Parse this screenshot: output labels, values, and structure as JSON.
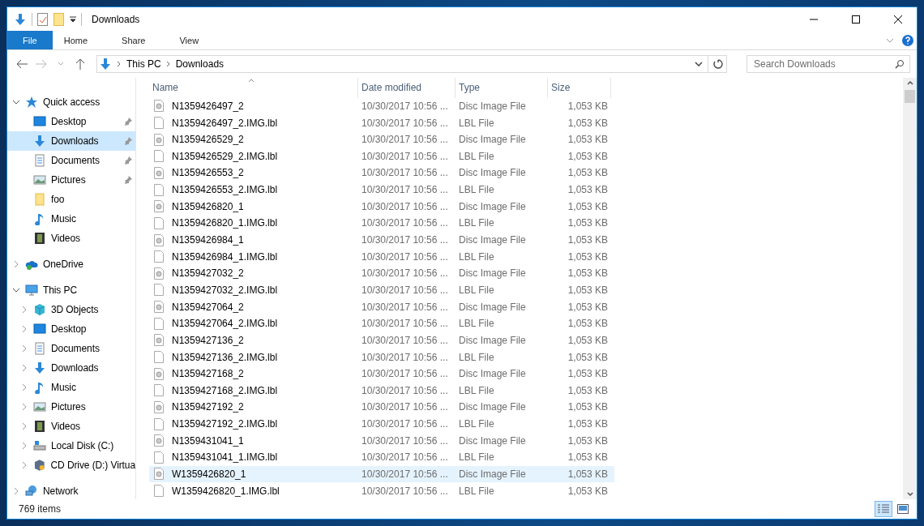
{
  "window": {
    "title": "Downloads"
  },
  "ribbon_tabs": [
    {
      "label": "File",
      "selected": true
    },
    {
      "label": "Home",
      "selected": false
    },
    {
      "label": "Share",
      "selected": false
    },
    {
      "label": "View",
      "selected": false
    }
  ],
  "breadcrumb": [
    "This PC",
    "Downloads"
  ],
  "search": {
    "placeholder": "Search Downloads"
  },
  "sidebar": [
    {
      "label": "Quick access",
      "kind": "star",
      "expanded": true,
      "children": [
        {
          "label": "Desktop",
          "kind": "desktop",
          "pinned": true,
          "selected": false
        },
        {
          "label": "Downloads",
          "kind": "download",
          "pinned": true,
          "selected": true
        },
        {
          "label": "Documents",
          "kind": "documents",
          "pinned": true,
          "selected": false
        },
        {
          "label": "Pictures",
          "kind": "pictures",
          "pinned": true,
          "selected": false
        },
        {
          "label": "foo",
          "kind": "folder",
          "pinned": false,
          "selected": false
        },
        {
          "label": "Music",
          "kind": "music",
          "pinned": false,
          "selected": false
        },
        {
          "label": "Videos",
          "kind": "videos",
          "pinned": false,
          "selected": false
        }
      ]
    },
    {
      "label": "OneDrive",
      "kind": "cloud",
      "expanded": false
    },
    {
      "label": "This PC",
      "kind": "pc",
      "expanded": true,
      "children": [
        {
          "label": "3D Objects",
          "kind": "cube",
          "expanded": false,
          "selected": false
        },
        {
          "label": "Desktop",
          "kind": "desktop",
          "expanded": false,
          "selected": false
        },
        {
          "label": "Documents",
          "kind": "documents",
          "expanded": false,
          "selected": false
        },
        {
          "label": "Downloads",
          "kind": "download",
          "expanded": false,
          "selected": false
        },
        {
          "label": "Music",
          "kind": "music",
          "expanded": false,
          "selected": false
        },
        {
          "label": "Pictures",
          "kind": "pictures",
          "expanded": false,
          "selected": false
        },
        {
          "label": "Videos",
          "kind": "videos",
          "expanded": false,
          "selected": false
        },
        {
          "label": "Local Disk (C:)",
          "kind": "disk",
          "expanded": false,
          "selected": false
        },
        {
          "label": "CD Drive (D:) Virtua",
          "kind": "cd",
          "expanded": false,
          "selected": false
        }
      ]
    },
    {
      "label": "Network",
      "kind": "network",
      "expanded": false
    }
  ],
  "table": {
    "columns": [
      "Name",
      "Date modified",
      "Type",
      "Size"
    ],
    "rows": [
      {
        "kind": "disc",
        "name": "N1359426497_2",
        "date": "10/30/2017 10:56 ...",
        "type": "Disc Image File",
        "size": "1,053 KB",
        "selected": false
      },
      {
        "kind": "lbl",
        "name": "N1359426497_2.IMG.lbl",
        "date": "10/30/2017 10:56 ...",
        "type": "LBL File",
        "size": "1,053 KB",
        "selected": false
      },
      {
        "kind": "disc",
        "name": "N1359426529_2",
        "date": "10/30/2017 10:56 ...",
        "type": "Disc Image File",
        "size": "1,053 KB",
        "selected": false
      },
      {
        "kind": "lbl",
        "name": "N1359426529_2.IMG.lbl",
        "date": "10/30/2017 10:56 ...",
        "type": "LBL File",
        "size": "1,053 KB",
        "selected": false
      },
      {
        "kind": "disc",
        "name": "N1359426553_2",
        "date": "10/30/2017 10:56 ...",
        "type": "Disc Image File",
        "size": "1,053 KB",
        "selected": false
      },
      {
        "kind": "lbl",
        "name": "N1359426553_2.IMG.lbl",
        "date": "10/30/2017 10:56 ...",
        "type": "LBL File",
        "size": "1,053 KB",
        "selected": false
      },
      {
        "kind": "disc",
        "name": "N1359426820_1",
        "date": "10/30/2017 10:56 ...",
        "type": "Disc Image File",
        "size": "1,053 KB",
        "selected": false
      },
      {
        "kind": "lbl",
        "name": "N1359426820_1.IMG.lbl",
        "date": "10/30/2017 10:56 ...",
        "type": "LBL File",
        "size": "1,053 KB",
        "selected": false
      },
      {
        "kind": "disc",
        "name": "N1359426984_1",
        "date": "10/30/2017 10:56 ...",
        "type": "Disc Image File",
        "size": "1,053 KB",
        "selected": false
      },
      {
        "kind": "lbl",
        "name": "N1359426984_1.IMG.lbl",
        "date": "10/30/2017 10:56 ...",
        "type": "LBL File",
        "size": "1,053 KB",
        "selected": false
      },
      {
        "kind": "disc",
        "name": "N1359427032_2",
        "date": "10/30/2017 10:56 ...",
        "type": "Disc Image File",
        "size": "1,053 KB",
        "selected": false
      },
      {
        "kind": "lbl",
        "name": "N1359427032_2.IMG.lbl",
        "date": "10/30/2017 10:56 ...",
        "type": "LBL File",
        "size": "1,053 KB",
        "selected": false
      },
      {
        "kind": "disc",
        "name": "N1359427064_2",
        "date": "10/30/2017 10:56 ...",
        "type": "Disc Image File",
        "size": "1,053 KB",
        "selected": false
      },
      {
        "kind": "lbl",
        "name": "N1359427064_2.IMG.lbl",
        "date": "10/30/2017 10:56 ...",
        "type": "LBL File",
        "size": "1,053 KB",
        "selected": false
      },
      {
        "kind": "disc",
        "name": "N1359427136_2",
        "date": "10/30/2017 10:56 ...",
        "type": "Disc Image File",
        "size": "1,053 KB",
        "selected": false
      },
      {
        "kind": "lbl",
        "name": "N1359427136_2.IMG.lbl",
        "date": "10/30/2017 10:56 ...",
        "type": "LBL File",
        "size": "1,053 KB",
        "selected": false
      },
      {
        "kind": "disc",
        "name": "N1359427168_2",
        "date": "10/30/2017 10:56 ...",
        "type": "Disc Image File",
        "size": "1,053 KB",
        "selected": false
      },
      {
        "kind": "lbl",
        "name": "N1359427168_2.IMG.lbl",
        "date": "10/30/2017 10:56 ...",
        "type": "LBL File",
        "size": "1,053 KB",
        "selected": false
      },
      {
        "kind": "disc",
        "name": "N1359427192_2",
        "date": "10/30/2017 10:56 ...",
        "type": "Disc Image File",
        "size": "1,053 KB",
        "selected": false
      },
      {
        "kind": "lbl",
        "name": "N1359427192_2.IMG.lbl",
        "date": "10/30/2017 10:56 ...",
        "type": "LBL File",
        "size": "1,053 KB",
        "selected": false
      },
      {
        "kind": "disc",
        "name": "N1359431041_1",
        "date": "10/30/2017 10:56 ...",
        "type": "Disc Image File",
        "size": "1,053 KB",
        "selected": false
      },
      {
        "kind": "lbl",
        "name": "N1359431041_1.IMG.lbl",
        "date": "10/30/2017 10:56 ...",
        "type": "LBL File",
        "size": "1,053 KB",
        "selected": false
      },
      {
        "kind": "disc",
        "name": "W1359426820_1",
        "date": "10/30/2017 10:56 ...",
        "type": "Disc Image File",
        "size": "1,053 KB",
        "selected": true
      },
      {
        "kind": "lbl",
        "name": "W1359426820_1.IMG.lbl",
        "date": "10/30/2017 10:56 ...",
        "type": "LBL File",
        "size": "1,053 KB",
        "selected": false
      }
    ]
  },
  "status_bar": {
    "count": "769 items",
    "view_buttons": [
      {
        "kind": "details",
        "selected": true
      },
      {
        "kind": "preview",
        "selected": false
      }
    ]
  }
}
